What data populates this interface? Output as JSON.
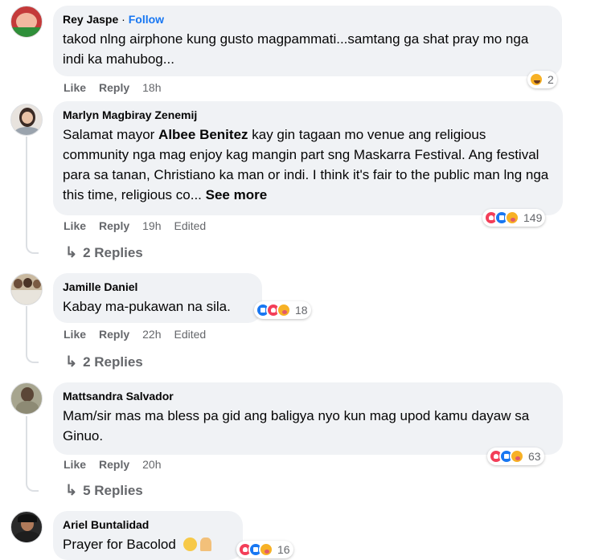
{
  "comments": [
    {
      "name": "Rey Jaspe",
      "separator": " · ",
      "follow": "Follow",
      "text": "takod nlng airphone kung gusto magpammati...samtang ga shat pray mo nga indi ka mahubog...",
      "like": "Like",
      "reply": "Reply",
      "time": "18h",
      "reaction_count": "2"
    },
    {
      "name": "Marlyn Magbiray Zenemij",
      "text_before": "Salamat mayor ",
      "text_bold": "Albee Benitez",
      "text_after": " kay gin tagaan mo venue ang religious community nga mag enjoy kag mangin part sng Maskarra Festival. Ang festival para sa tanan, Christiano ka man or indi. I think it's fair to the public man lng nga this time, religious co... ",
      "see_more": "See more",
      "like": "Like",
      "reply": "Reply",
      "time": "19h",
      "edited": "Edited",
      "reaction_count": "149",
      "replies": "2 Replies"
    },
    {
      "name": "Jamille Daniel",
      "text": "Kabay ma-pukawan na sila.",
      "like": "Like",
      "reply": "Reply",
      "time": "22h",
      "edited": "Edited",
      "reaction_count": "18",
      "replies": "2 Replies"
    },
    {
      "name": "Mattsandra Salvador",
      "text": "Mam/sir mas ma bless pa gid ang baligya nyo kun mag upod kamu dayaw sa Ginuo.",
      "like": "Like",
      "reply": "Reply",
      "time": "20h",
      "reaction_count": "63",
      "replies": "5 Replies"
    },
    {
      "name": "Ariel Buntalidad",
      "text": "Prayer for Bacolod",
      "reaction_count": "16"
    }
  ],
  "icons": {
    "reply_arrow": "reply-arrow-icon",
    "like": "like-reaction-icon",
    "love": "love-reaction-icon",
    "care": "care-reaction-icon",
    "haha": "haha-reaction-icon"
  },
  "colors": {
    "bubble": "#f0f2f5",
    "link": "#1877f2",
    "muted": "#65676b",
    "like": "#1877f2",
    "love": "#f33e58",
    "care": "#f7b125"
  }
}
